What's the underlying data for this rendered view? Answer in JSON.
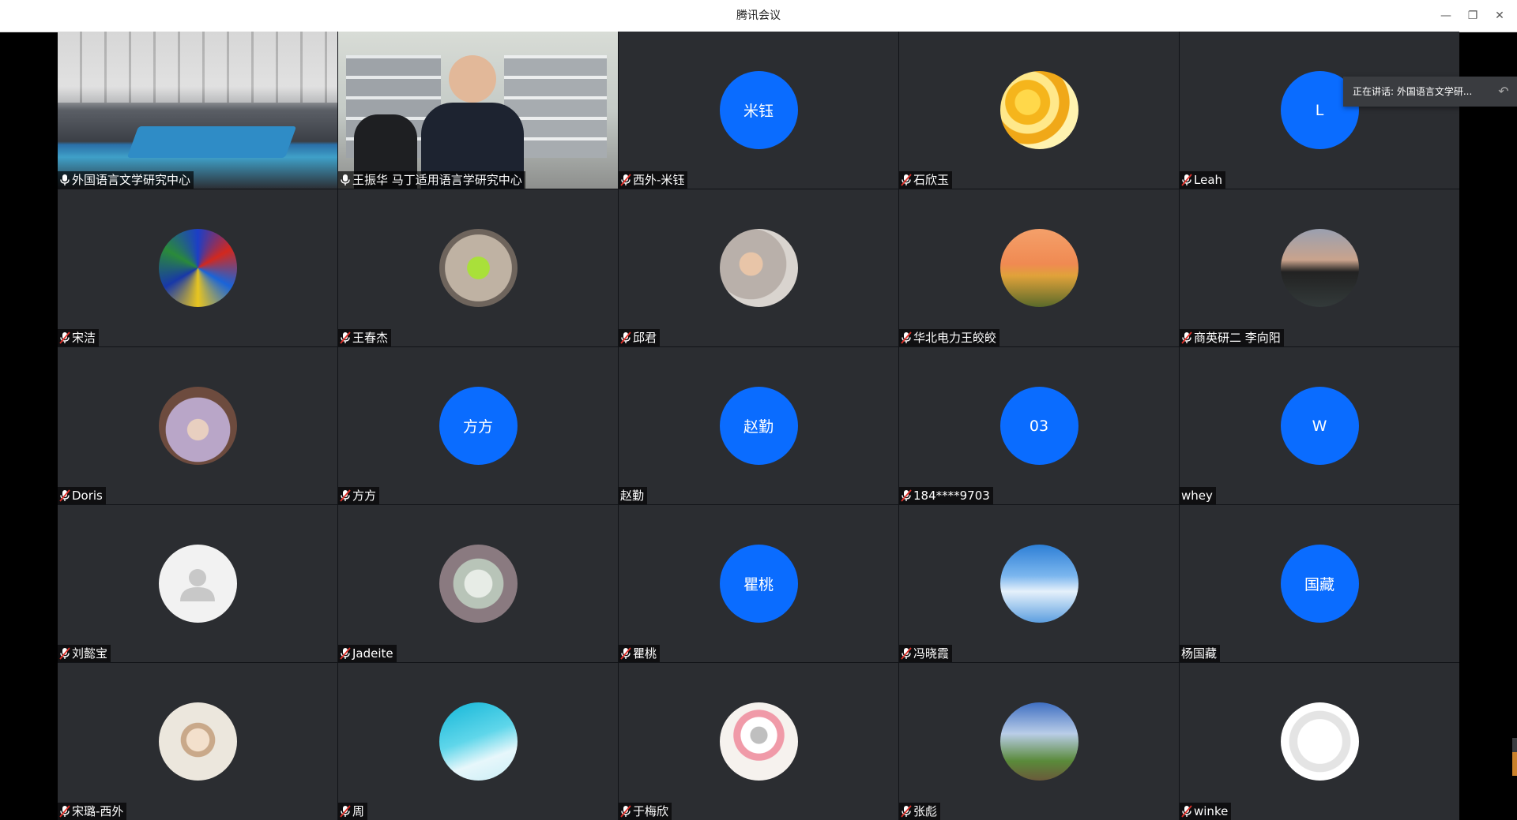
{
  "window": {
    "title": "腾讯会议",
    "minimize_label": "—",
    "restore_label": "❐",
    "close_label": "✕"
  },
  "speaking_banner": {
    "text": "正在讲话: 外国语言文学研...",
    "collapse_icon": "reply-icon"
  },
  "colors": {
    "avatar_blue": "#0a6cff",
    "tile_bg": "#2b2d31",
    "active_border": "#19c37d"
  },
  "participants": [
    {
      "name": "外国语言文学研究中心",
      "avatar": "video-room",
      "mic": "on",
      "active": true
    },
    {
      "name": "王振华 马丁适用语言学研究中心",
      "avatar": "video-office",
      "mic": "on"
    },
    {
      "name": "西外-米钰",
      "avatar_text": "米钰",
      "mic": "muted"
    },
    {
      "name": "石欣玉",
      "avatar": "photo-yellow-flowers",
      "mic": "muted"
    },
    {
      "name": "Leah",
      "avatar_text": "L",
      "mic": "muted"
    },
    {
      "name": "宋洁",
      "avatar": "photo-stained-glass",
      "mic": "muted"
    },
    {
      "name": "王春杰",
      "avatar": "photo-green-flower",
      "mic": "muted"
    },
    {
      "name": "邱君",
      "avatar": "photo-child",
      "mic": "muted"
    },
    {
      "name": "华北电力王皎皎",
      "avatar": "photo-sunflowers",
      "mic": "muted"
    },
    {
      "name": "商英研二 李向阳",
      "avatar": "photo-dusk-lake",
      "mic": "muted"
    },
    {
      "name": "Doris",
      "avatar": "photo-girl-blanket",
      "mic": "muted"
    },
    {
      "name": "方方",
      "avatar_text": "方方",
      "mic": "muted"
    },
    {
      "name": "赵勤",
      "avatar_text": "赵勤",
      "mic": "none"
    },
    {
      "name": "184****9703",
      "avatar_text": "03",
      "mic": "muted"
    },
    {
      "name": "whey",
      "avatar_text": "W",
      "mic": "none"
    },
    {
      "name": "刘懿宝",
      "avatar": "default-person",
      "mic": "muted"
    },
    {
      "name": "Jadeite",
      "avatar": "photo-succulents",
      "mic": "muted"
    },
    {
      "name": "瞿桃",
      "avatar_text": "瞿桃",
      "mic": "muted"
    },
    {
      "name": "冯晓霞",
      "avatar": "photo-blue-sky",
      "mic": "muted"
    },
    {
      "name": "杨国藏",
      "avatar_text": "国藏",
      "mic": "none"
    },
    {
      "name": "宋璐-西外",
      "avatar": "photo-woman",
      "mic": "muted"
    },
    {
      "name": "周",
      "avatar": "photo-ocean",
      "mic": "muted"
    },
    {
      "name": "于梅欣",
      "avatar": "photo-bird-dancer",
      "mic": "muted"
    },
    {
      "name": "张彪",
      "avatar": "photo-clouds-field",
      "mic": "muted"
    },
    {
      "name": "winke",
      "avatar": "photo-dog-drawing",
      "mic": "muted"
    }
  ]
}
